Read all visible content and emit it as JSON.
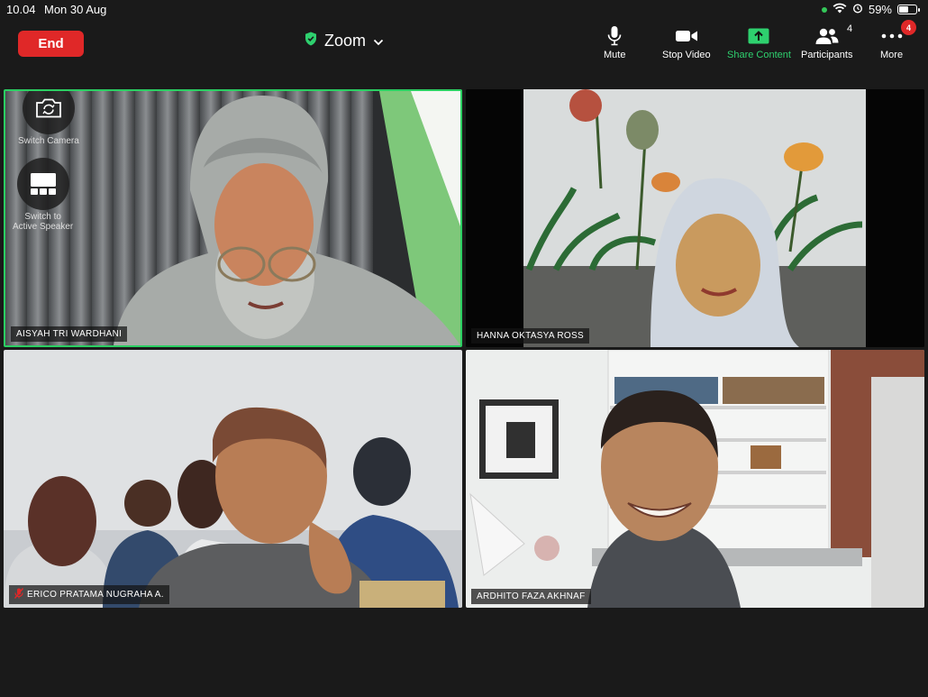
{
  "status_bar": {
    "time": "10.04",
    "date": "Mon 30 Aug",
    "battery": "59%",
    "battery_level": 0.59
  },
  "end_button": {
    "label": "End"
  },
  "app": {
    "title": "Zoom"
  },
  "toolbar": {
    "mute": "Mute",
    "stop_video": "Stop Video",
    "share_content": "Share Content",
    "participants": "Participants",
    "participants_count": "4",
    "more": "More",
    "more_badge": "4"
  },
  "side_controls": {
    "switch_camera": "Switch Camera",
    "switch_speaker_1": "Switch to",
    "switch_speaker_2": "Active Speaker"
  },
  "participants": [
    {
      "name": "AISYAH TRI WARDHANI",
      "active": true
    },
    {
      "name": "HANNA OKTASYA ROSS",
      "active": false
    },
    {
      "name": "ERICO PRATAMA NUGRAHA A.",
      "muted": true
    },
    {
      "name": "ARDHITO FAZA AKHNAF",
      "active": false
    }
  ],
  "colors": {
    "end": "#e02828",
    "share": "#2ed06e",
    "active_speaker_border": "#2bcf62"
  }
}
